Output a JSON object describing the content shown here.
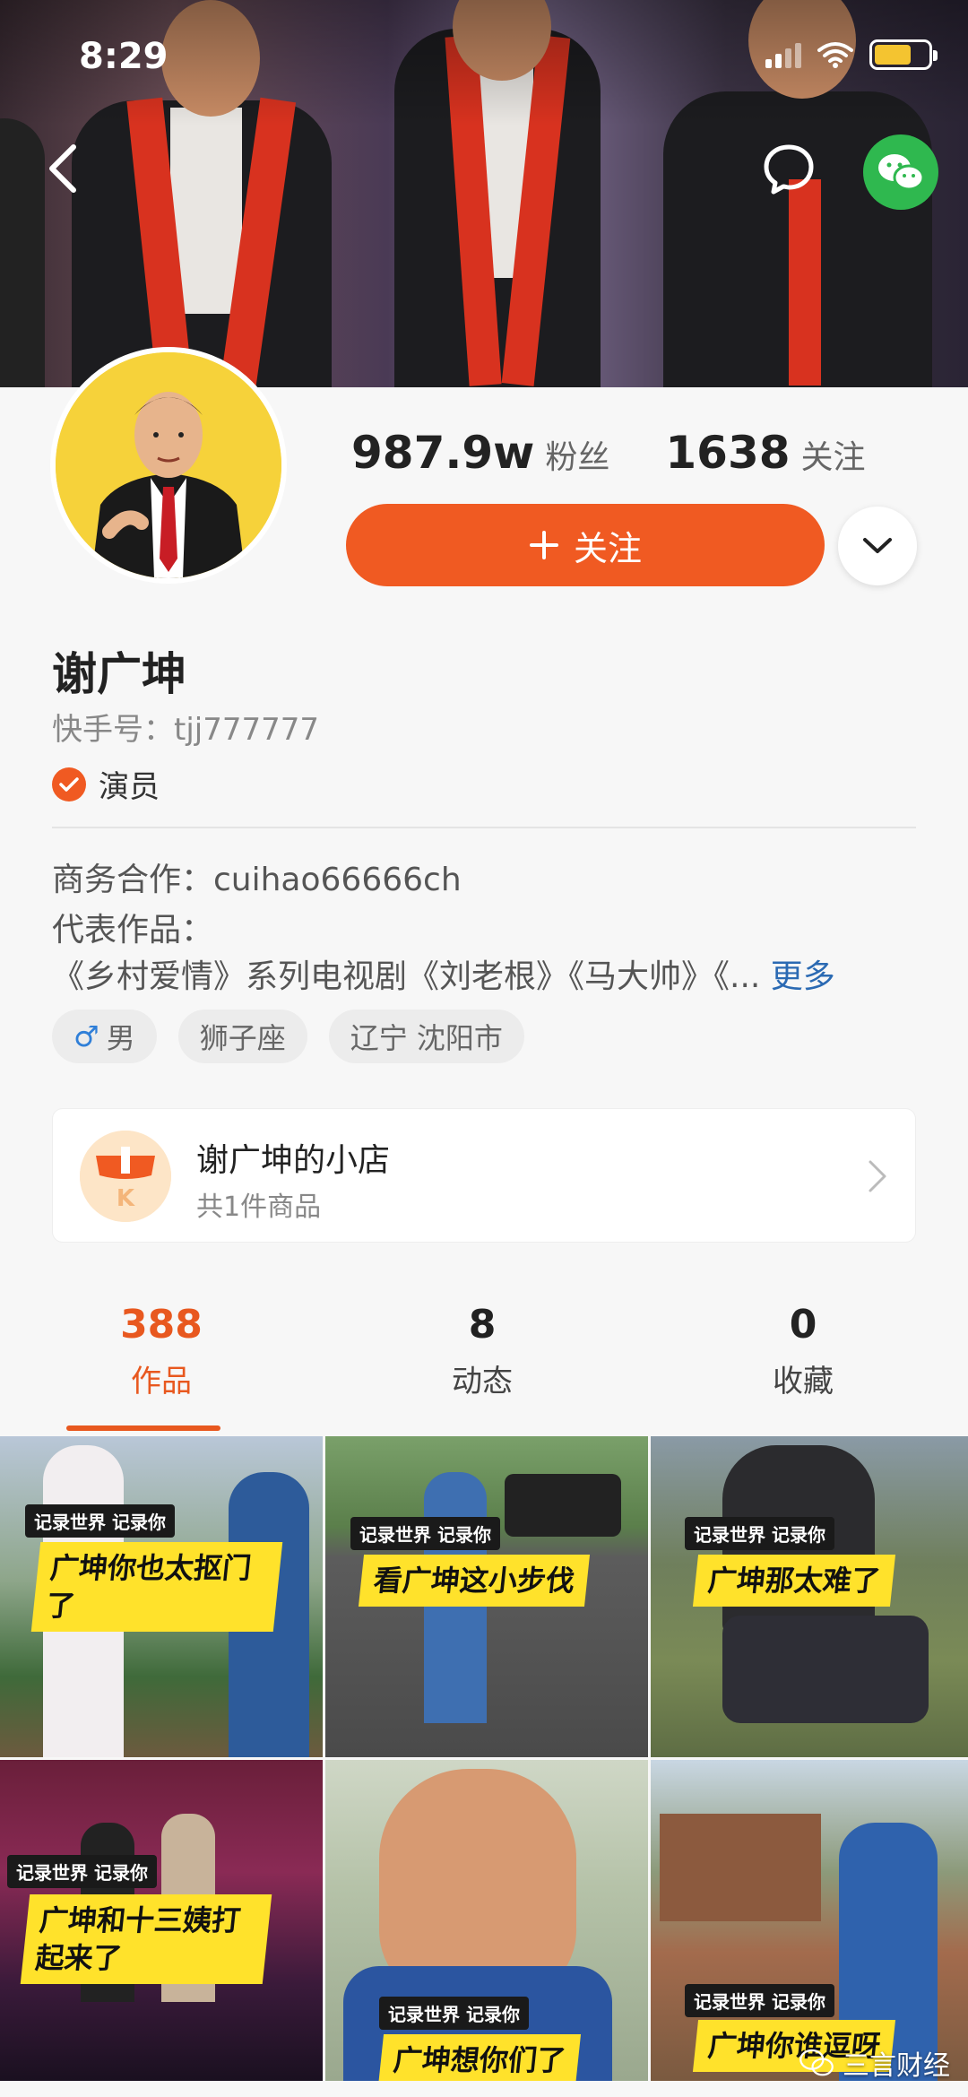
{
  "status_bar": {
    "time": "8:29"
  },
  "profile": {
    "fans_count": "987.9w",
    "fans_label": "粉丝",
    "following_count": "1638",
    "following_label": "关注",
    "follow_button": "关注",
    "name": "谢广坤",
    "kuaishou_id": "快手号：tjj777777",
    "verification": "演员",
    "business": "商务合作：cuihao66666ch",
    "works_label": "代表作品：",
    "works_text": "《乡村爱情》系列电视剧《刘老根》《马大帅》《...",
    "more_label": "更多",
    "tags": [
      "男",
      "狮子座",
      "辽宁 沈阳市"
    ]
  },
  "shop": {
    "title": "谢广坤的小店",
    "subtitle": "共1件商品",
    "icon_letter": "K"
  },
  "tabs": [
    {
      "count": "388",
      "label": "作品"
    },
    {
      "count": "8",
      "label": "动态"
    },
    {
      "count": "0",
      "label": "收藏"
    }
  ],
  "videos": [
    {
      "badge": "记录世界 记录你",
      "caption": "广坤你也太抠门了"
    },
    {
      "badge": "记录世界 记录你",
      "caption": "看广坤这小步伐"
    },
    {
      "badge": "记录世界 记录你",
      "caption": "广坤那太难了"
    },
    {
      "badge": "记录世界 记录你",
      "caption": "广坤和十三姨打起来了"
    },
    {
      "badge": "记录世界 记录你",
      "caption": "广坤想你们了"
    },
    {
      "badge": "记录世界 记录你",
      "caption": "广坤你谁逗呀"
    }
  ],
  "watermark": "三言财经",
  "colors": {
    "accent": "#f05a22",
    "link": "#2b6ab3",
    "caption_bg": "#ffe22b",
    "wechat": "#2fb84f"
  },
  "icons": {
    "back": "chevron-left-icon",
    "message": "chat-bubble-icon",
    "wechat": "wechat-icon",
    "dropdown": "chevron-down-icon",
    "male": "male-symbol-icon",
    "verified": "check-circle-icon",
    "shop_arrow": "chevron-right-icon"
  }
}
